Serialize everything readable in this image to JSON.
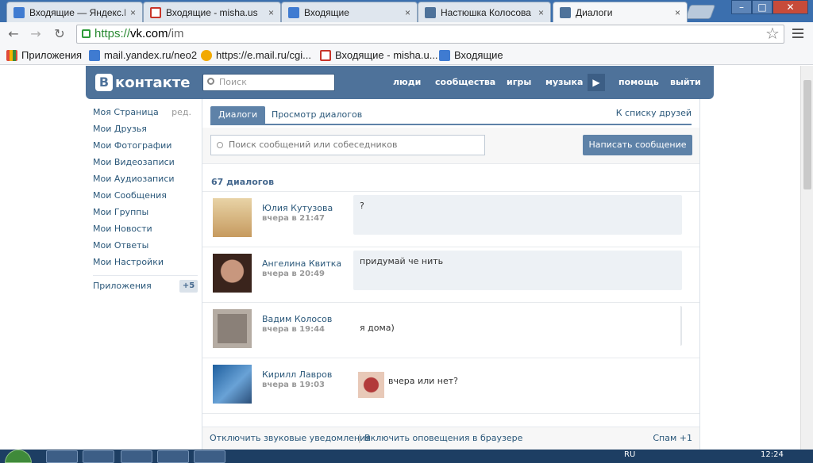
{
  "browser": {
    "tabs": [
      {
        "title": "Входящие — Яндекс.Н",
        "icon": "mail-icon",
        "active": false
      },
      {
        "title": "Входящие - misha.us",
        "icon": "gmail-icon",
        "active": false
      },
      {
        "title": "Входящие",
        "icon": "mail-icon",
        "active": false
      },
      {
        "title": "Настюшка Колосова",
        "icon": "vk-icon",
        "active": false
      },
      {
        "title": "Диалоги",
        "icon": "vk-messages-icon",
        "active": true
      }
    ],
    "tab_close": "×",
    "url_protocol": "https://",
    "url_host": "vk.com",
    "url_path": "/im",
    "bookmarks": [
      {
        "label": "Приложения",
        "icon": "apps-grid-icon"
      },
      {
        "label": "mail.yandex.ru/neo2",
        "icon": "mail-icon"
      },
      {
        "label": "https://e.mail.ru/cgi...",
        "icon": "at-sign-icon"
      },
      {
        "label": "Входящие - misha.u...",
        "icon": "gmail-icon"
      },
      {
        "label": "Входящие",
        "icon": "mail-icon"
      }
    ],
    "colors": {
      "tabstrip": "#3b6fae",
      "secure": "#2a8a33"
    }
  },
  "vk": {
    "logo_letter": "В",
    "logo_text": "контакте",
    "search_placeholder": "Поиск",
    "nav": [
      "люди",
      "сообщества",
      "игры",
      "музыка",
      "помощь",
      "выйти"
    ],
    "play_glyph": "▶",
    "colors": {
      "header": "#4e729a",
      "link": "#2b587a",
      "accent": "#5e82a8"
    }
  },
  "sidebar": {
    "items": [
      {
        "label": "Моя Страница",
        "extra": "ред."
      },
      {
        "label": "Мои Друзья"
      },
      {
        "label": "Мои Фотографии"
      },
      {
        "label": "Мои Видеозаписи"
      },
      {
        "label": "Мои Аудиозаписи"
      },
      {
        "label": "Мои Сообщения"
      },
      {
        "label": "Мои Группы"
      },
      {
        "label": "Мои Новости"
      },
      {
        "label": "Мои Ответы"
      },
      {
        "label": "Мои Настройки"
      }
    ],
    "apps_label": "Приложения",
    "apps_badge": "+5"
  },
  "main": {
    "tabs": [
      "Диалоги",
      "Просмотр диалогов"
    ],
    "friends_link": "К списку друзей",
    "search_placeholder": "Поиск сообщений или собеседников",
    "write_button": "Написать сообщение",
    "dialog_count": "67 диалогов",
    "dialogs": [
      {
        "name": "Юлия Кутузова",
        "time": "вчера в 21:47",
        "text": "?",
        "unread": true,
        "avatar_color": "#d9b37c"
      },
      {
        "name": "Ангелина Квитка",
        "time": "вчера в 20:49",
        "text": "придумай че нить",
        "unread": true,
        "avatar_color": "#5a3b2f"
      },
      {
        "name": "Вадим Колосов",
        "time": "вчера в 19:44",
        "text": "я дома)",
        "unread": false,
        "avatar_color": "#8a8078"
      },
      {
        "name": "Кирилл Лавров",
        "time": "вчера в 19:03",
        "text": "вчера или нет?",
        "unread": false,
        "avatar_color": "#2f6aa8",
        "self_avatar_color": "#b23a3a"
      }
    ],
    "footer": {
      "sound": "Отключить звуковые уведомления",
      "separator": "|",
      "browser_alerts": "Включить оповещения в браузере",
      "spam": "Спам +1"
    }
  },
  "taskbar": {
    "lang": "RU",
    "clock": "12:24"
  }
}
